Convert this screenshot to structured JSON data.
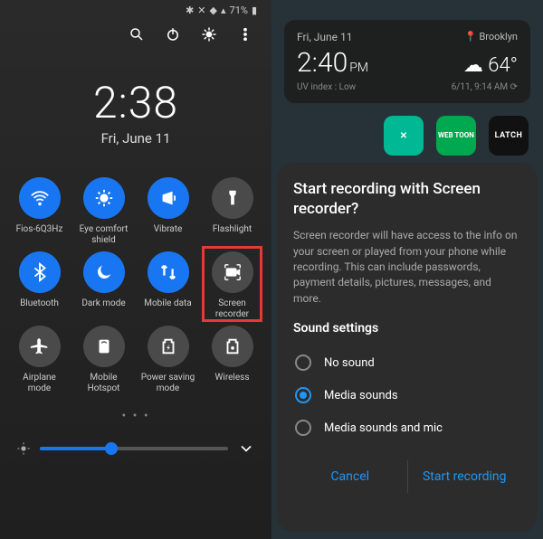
{
  "status": {
    "battery": "71%",
    "icons": [
      "bluetooth",
      "mute",
      "wifi",
      "signal",
      "signal2"
    ]
  },
  "left": {
    "time": "2:38",
    "date": "Fri, June 11",
    "toggles": [
      {
        "label": "Fios-6Q3Hz",
        "on": true,
        "icon": "wifi"
      },
      {
        "label": "Eye comfort shield",
        "on": true,
        "icon": "eyecomfort"
      },
      {
        "label": "Vibrate",
        "on": true,
        "icon": "vibrate"
      },
      {
        "label": "Flashlight",
        "on": false,
        "icon": "flashlight"
      },
      {
        "label": "Bluetooth",
        "on": true,
        "icon": "bluetooth"
      },
      {
        "label": "Dark mode",
        "on": true,
        "icon": "moon"
      },
      {
        "label": "Mobile data",
        "on": true,
        "icon": "data"
      },
      {
        "label": "Screen recorder",
        "on": false,
        "icon": "record",
        "highlight": true
      },
      {
        "label": "Airplane mode",
        "on": false,
        "icon": "airplane"
      },
      {
        "label": "Mobile Hotspot",
        "on": false,
        "icon": "hotspot"
      },
      {
        "label": "Power saving mode",
        "on": false,
        "icon": "powersave"
      },
      {
        "label": "Wireless",
        "on": false,
        "icon": "wireless"
      }
    ]
  },
  "right": {
    "date": "Fri, June 11",
    "location": "Brooklyn",
    "time": "2:40",
    "ampm": "PM",
    "temp": "64°",
    "uv": "UV index : Low",
    "updated": "6/11, 9:14 AM",
    "apps": [
      "X",
      "WEB TOON",
      "LATCH"
    ],
    "dialog": {
      "title": "Start recording with Screen recorder?",
      "body": "Screen recorder will have access to the info on your screen or played from your phone while recording. This can include passwords, payment details, pictures, messages, and more.",
      "sound_header": "Sound settings",
      "options": [
        "No sound",
        "Media sounds",
        "Media sounds and mic"
      ],
      "selected": 1,
      "cancel": "Cancel",
      "start": "Start recording"
    }
  }
}
